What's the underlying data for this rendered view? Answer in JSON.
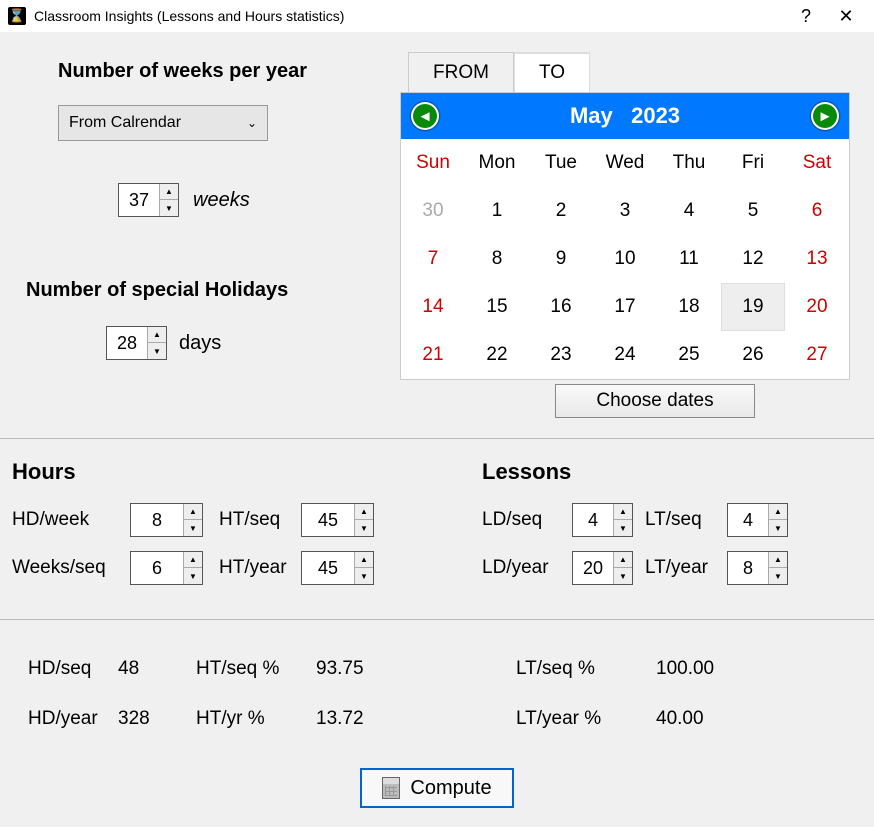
{
  "title": "Classroom Insights (Lessons and Hours statistics)",
  "weeks_per_year_label": "Number of weeks per year",
  "dropdown": {
    "selected": "From Calrendar"
  },
  "weeks": {
    "value": "37",
    "label": "weeks"
  },
  "holidays_label": "Number of special Holidays",
  "days": {
    "value": "28",
    "label": "days"
  },
  "tabs": {
    "from": "FROM",
    "to": "TO"
  },
  "calendar": {
    "month": "May",
    "year": "2023",
    "headers": [
      "Sun",
      "Mon",
      "Tue",
      "Wed",
      "Thu",
      "Fri",
      "Sat"
    ],
    "cells": [
      {
        "d": "30",
        "cls": "gray"
      },
      {
        "d": "1"
      },
      {
        "d": "2"
      },
      {
        "d": "3"
      },
      {
        "d": "4"
      },
      {
        "d": "5"
      },
      {
        "d": "6",
        "cls": "red"
      },
      {
        "d": "7",
        "cls": "red"
      },
      {
        "d": "8"
      },
      {
        "d": "9"
      },
      {
        "d": "10"
      },
      {
        "d": "11"
      },
      {
        "d": "12"
      },
      {
        "d": "13",
        "cls": "red"
      },
      {
        "d": "14",
        "cls": "red"
      },
      {
        "d": "15"
      },
      {
        "d": "16"
      },
      {
        "d": "17"
      },
      {
        "d": "18"
      },
      {
        "d": "19",
        "sel": true
      },
      {
        "d": "20",
        "cls": "red"
      },
      {
        "d": "21",
        "cls": "red"
      },
      {
        "d": "22"
      },
      {
        "d": "23"
      },
      {
        "d": "24"
      },
      {
        "d": "25"
      },
      {
        "d": "26"
      },
      {
        "d": "27",
        "cls": "red"
      }
    ]
  },
  "choose_dates": "Choose dates",
  "hours": {
    "title": "Hours",
    "hd_week": {
      "label": "HD/week",
      "value": "8"
    },
    "ht_seq": {
      "label": "HT/seq",
      "value": "45"
    },
    "weeks_seq": {
      "label": "Weeks/seq",
      "value": "6"
    },
    "ht_year": {
      "label": "HT/year",
      "value": "45"
    }
  },
  "lessons": {
    "title": "Lessons",
    "ld_seq": {
      "label": "LD/seq",
      "value": "4"
    },
    "lt_seq": {
      "label": "LT/seq",
      "value": "4"
    },
    "ld_year": {
      "label": "LD/year",
      "value": "20"
    },
    "lt_year": {
      "label": "LT/year",
      "value": "8"
    }
  },
  "stats": {
    "hd_seq": {
      "label": "HD/seq",
      "value": "48"
    },
    "hd_year": {
      "label": "HD/year",
      "value": "328"
    },
    "ht_seq_p": {
      "label": "HT/seq %",
      "value": "93.75"
    },
    "ht_yr_p": {
      "label": "HT/yr %",
      "value": "13.72"
    },
    "lt_seq_p": {
      "label": "LT/seq %",
      "value": "100.00"
    },
    "lt_yr_p": {
      "label": "LT/year %",
      "value": "40.00"
    }
  },
  "compute": "Compute"
}
